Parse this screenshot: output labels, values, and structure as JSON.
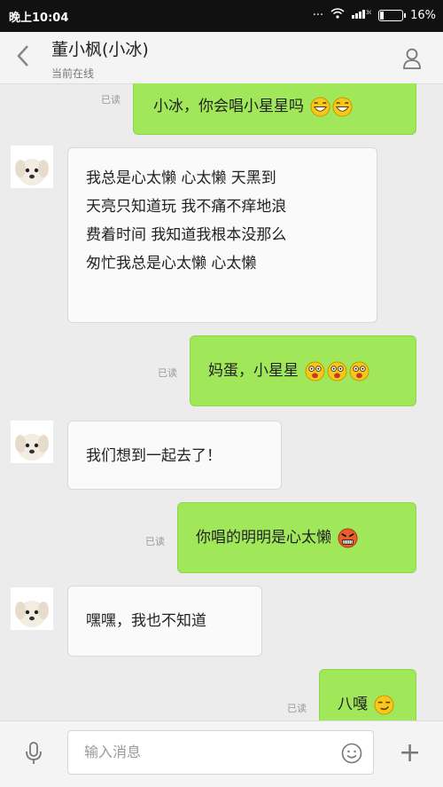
{
  "status": {
    "time": "晚上10:04",
    "battery": "16%",
    "network": "3G"
  },
  "header": {
    "title": "董小枫(小冰)",
    "subtitle": "当前在线"
  },
  "messages": [
    {
      "side": "out",
      "text": "小冰，你会唱小星星吗",
      "read": "已读",
      "emoji": "grin,grin"
    },
    {
      "side": "in",
      "lines": [
        "我总是心太懒  心太懒  天黑到",
        "天亮只知道玩  我不痛不痒地浪",
        "费着时间  我知道我根本没那么",
        "匆忙我总是心太懒  心太懒"
      ]
    },
    {
      "side": "out",
      "text": "妈蛋，小星星",
      "read": "已读",
      "emoji": "shocked,shocked,shocked"
    },
    {
      "side": "in",
      "text": "我们想到一起去了！"
    },
    {
      "side": "out",
      "text": "你唱的明明是心太懒",
      "read": "已读",
      "emoji": "angry"
    },
    {
      "side": "in",
      "text": "嘿嘿，我也不知道"
    },
    {
      "side": "out",
      "text": "八嘎",
      "read": "已读",
      "emoji": "smirk"
    }
  ],
  "input": {
    "placeholder": "输入消息"
  },
  "colors": {
    "outgoing": "#a0e75a",
    "incoming": "#fafafa",
    "background": "#ececec"
  },
  "icons": [
    "back-arrow-icon",
    "profile-icon",
    "microphone-icon",
    "emoji-icon",
    "plus-icon",
    "wifi-icon",
    "signal-icon",
    "battery-icon"
  ]
}
